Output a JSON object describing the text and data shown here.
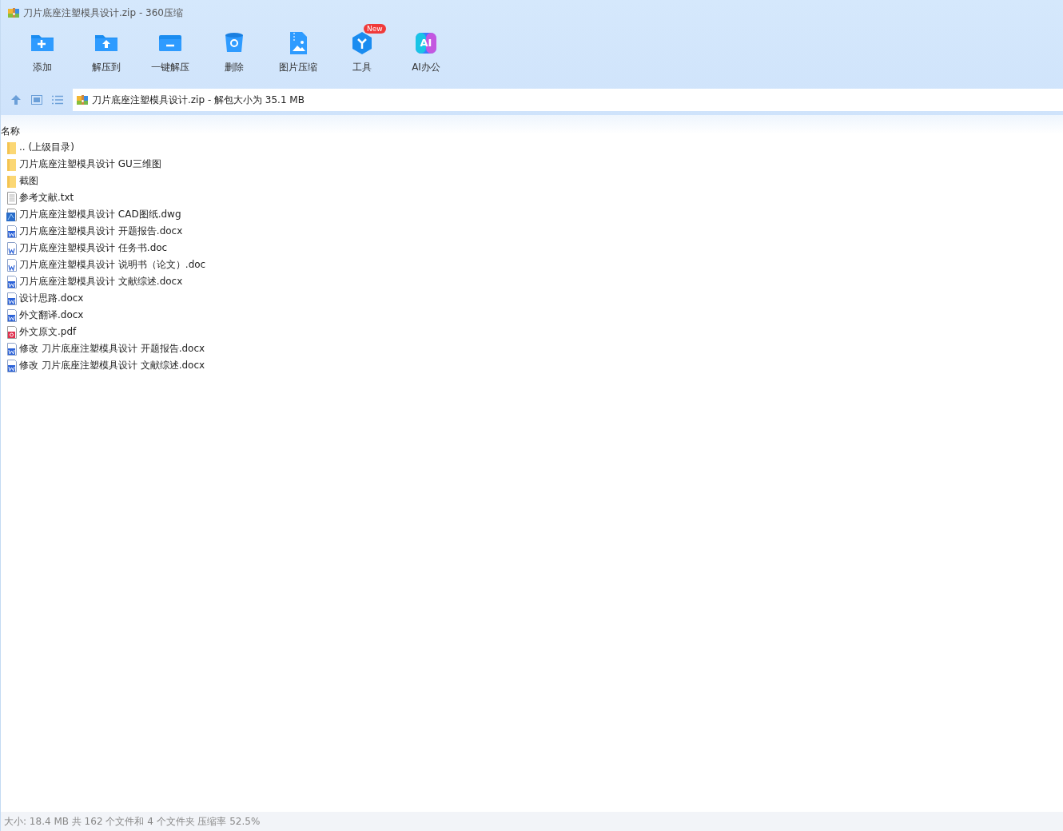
{
  "window": {
    "title": "刀片底座注塑模具设计.zip - 360压缩"
  },
  "toolbar": [
    {
      "kind": "add",
      "label": "添加"
    },
    {
      "kind": "extract",
      "label": "解压到"
    },
    {
      "kind": "oneclick",
      "label": "一键解压"
    },
    {
      "kind": "delete",
      "label": "删除"
    },
    {
      "kind": "image",
      "label": "图片压缩"
    },
    {
      "kind": "tools",
      "label": "工具",
      "badge": "New"
    },
    {
      "kind": "ai",
      "label": "AI办公",
      "icon_text": "AI"
    }
  ],
  "address_bar": {
    "path": "刀片底座注塑模具设计.zip - 解包大小为 35.1 MB"
  },
  "file_list": {
    "columns": [
      "名称"
    ],
    "rows": [
      {
        "kind": "folder",
        "name": ".. (上级目录)"
      },
      {
        "kind": "folder",
        "name": "刀片底座注塑模具设计 GU三维图"
      },
      {
        "kind": "folder",
        "name": "截图"
      },
      {
        "kind": "txt",
        "name": "参考文献.txt"
      },
      {
        "kind": "dwg",
        "name": "刀片底座注塑模具设计 CAD图纸.dwg"
      },
      {
        "kind": "docx",
        "name": "刀片底座注塑模具设计 开题报告.docx"
      },
      {
        "kind": "doc",
        "name": "刀片底座注塑模具设计 任务书.doc"
      },
      {
        "kind": "doc",
        "name": "刀片底座注塑模具设计 说明书（论文）.doc"
      },
      {
        "kind": "docx",
        "name": "刀片底座注塑模具设计 文献综述.docx"
      },
      {
        "kind": "docx",
        "name": "设计思路.docx"
      },
      {
        "kind": "docx",
        "name": "外文翻译.docx"
      },
      {
        "kind": "pdf",
        "name": "外文原文.pdf"
      },
      {
        "kind": "docx",
        "name": "修改 刀片底座注塑模具设计 开题报告.docx"
      },
      {
        "kind": "docx",
        "name": "修改 刀片底座注塑模具设计 文献综述.docx"
      }
    ]
  },
  "status_bar": {
    "text": "大小: 18.4 MB 共 162 个文件和 4 个文件夹 压缩率 52.5%"
  }
}
